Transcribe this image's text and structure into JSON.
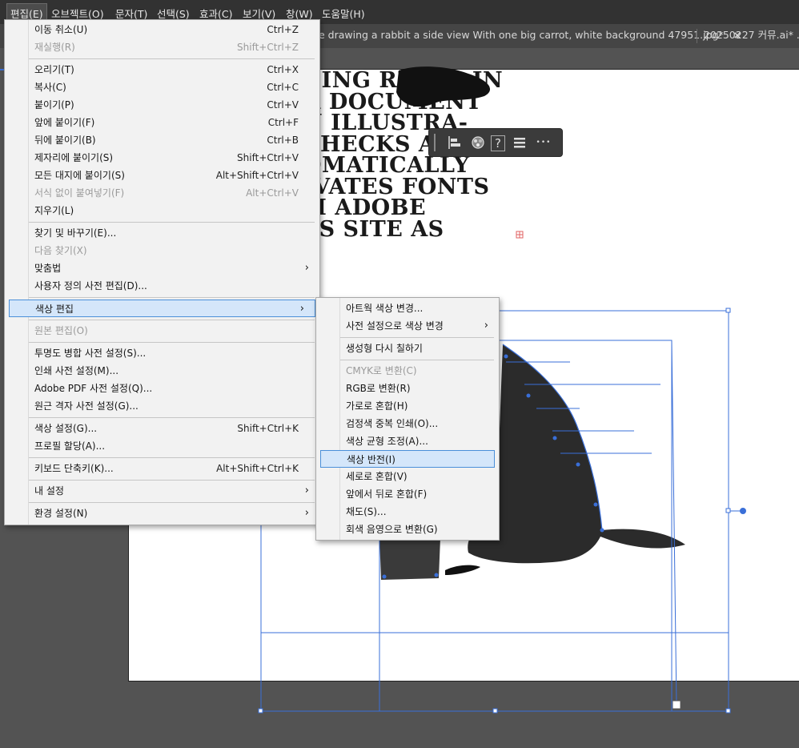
{
  "menubar": {
    "items": [
      "편집(E)",
      "오브젝트(O)",
      "문자(T)",
      "선택(S)",
      "효과(C)",
      "보기(V)",
      "창(W)",
      "도움말(H)"
    ]
  },
  "tabs": [
    {
      "label": "e drawing a rabbit a side view With one big carrot, white background 47951.jpg*",
      "close": "×"
    },
    {
      "label": "20250227 커뮤.ai* ..."
    }
  ],
  "artwork_text": [
    "GING RECTS IN",
    "R DOCUMENT",
    "N ILLUSTRA-",
    " CHECKS AND",
    "OMATICALLY",
    "IVATES FONTS",
    "M ADOBE",
    "TS SITE AS"
  ],
  "toolbar_icons": [
    "align-icon",
    "recolor-icon",
    "help-icon",
    "menu-lines-icon",
    "more-icon"
  ],
  "toolbar_help_glyph": "?",
  "toolbar_more_glyph": "•••",
  "edit_menu": {
    "items": [
      {
        "label": "이동 취소(U)",
        "shortcut": "Ctrl+Z",
        "disabled": false
      },
      {
        "label": "재실행(R)",
        "shortcut": "Shift+Ctrl+Z",
        "disabled": true
      },
      {
        "sep": true
      },
      {
        "label": "오리기(T)",
        "shortcut": "Ctrl+X",
        "disabled": false
      },
      {
        "label": "복사(C)",
        "shortcut": "Ctrl+C",
        "disabled": false
      },
      {
        "label": "붙이기(P)",
        "shortcut": "Ctrl+V",
        "disabled": false
      },
      {
        "label": "앞에 붙이기(F)",
        "shortcut": "Ctrl+F",
        "disabled": false
      },
      {
        "label": "뒤에 붙이기(B)",
        "shortcut": "Ctrl+B",
        "disabled": false
      },
      {
        "label": "제자리에 붙이기(S)",
        "shortcut": "Shift+Ctrl+V",
        "disabled": false
      },
      {
        "label": "모든 대지에 붙이기(S)",
        "shortcut": "Alt+Shift+Ctrl+V",
        "disabled": false
      },
      {
        "label": "서식 없이 붙여넣기(F)",
        "shortcut": "Alt+Ctrl+V",
        "disabled": true
      },
      {
        "label": "지우기(L)",
        "shortcut": "",
        "disabled": false
      },
      {
        "sep": true
      },
      {
        "label": "찾기 및 바꾸기(E)...",
        "shortcut": "",
        "disabled": false
      },
      {
        "label": "다음 찾기(X)",
        "shortcut": "",
        "disabled": true
      },
      {
        "label": "맞춤법",
        "shortcut": "",
        "disabled": false,
        "submenu": true
      },
      {
        "label": "사용자 정의 사전 편집(D)...",
        "shortcut": "",
        "disabled": false
      },
      {
        "sep": true
      },
      {
        "label": "색상 편집",
        "shortcut": "",
        "disabled": false,
        "submenu": true,
        "highlighted": true
      },
      {
        "sep": true
      },
      {
        "label": "원본 편집(O)",
        "shortcut": "",
        "disabled": true
      },
      {
        "sep": true
      },
      {
        "label": "투명도 병합 사전 설정(S)...",
        "shortcut": "",
        "disabled": false
      },
      {
        "label": "인쇄 사전 설정(M)...",
        "shortcut": "",
        "disabled": false
      },
      {
        "label": "Adobe PDF 사전 설정(Q)...",
        "shortcut": "",
        "disabled": false
      },
      {
        "label": "원근 격자 사전 설정(G)...",
        "shortcut": "",
        "disabled": false
      },
      {
        "sep": true
      },
      {
        "label": "색상 설정(G)...",
        "shortcut": "Shift+Ctrl+K",
        "disabled": false
      },
      {
        "label": "프로필 할당(A)...",
        "shortcut": "",
        "disabled": false
      },
      {
        "sep": true
      },
      {
        "label": "키보드 단축키(K)...",
        "shortcut": "Alt+Shift+Ctrl+K",
        "disabled": false
      },
      {
        "sep": true
      },
      {
        "label": "내 설정",
        "shortcut": "",
        "disabled": false,
        "submenu": true
      },
      {
        "sep": true
      },
      {
        "label": "환경 설정(N)",
        "shortcut": "",
        "disabled": false,
        "submenu": true
      }
    ]
  },
  "color_submenu": {
    "items": [
      {
        "label": "아트웍 색상 변경...",
        "disabled": false
      },
      {
        "label": "사전 설정으로 색상 변경",
        "disabled": false,
        "submenu": true
      },
      {
        "sep": true
      },
      {
        "label": "생성형 다시 칠하기",
        "disabled": false
      },
      {
        "sep": true
      },
      {
        "label": "CMYK로 변환(C)",
        "disabled": true
      },
      {
        "label": "RGB로 변환(R)",
        "disabled": false
      },
      {
        "label": "가로로 혼합(H)",
        "disabled": false
      },
      {
        "label": "검정색 중복 인쇄(O)...",
        "disabled": false
      },
      {
        "label": "색상 균형 조정(A)...",
        "disabled": false
      },
      {
        "label": "색상 반전(I)",
        "disabled": false,
        "highlighted": true
      },
      {
        "label": "세로로 혼합(V)",
        "disabled": false
      },
      {
        "label": "앞에서 뒤로 혼합(F)",
        "disabled": false
      },
      {
        "label": "채도(S)...",
        "disabled": false
      },
      {
        "label": "회색 음영으로 변환(G)",
        "disabled": false
      }
    ]
  },
  "colors": {
    "selection": "#3a6fd8",
    "menu_bg": "#f2f2f2",
    "highlight_bg": "#d4e6fa",
    "highlight_border": "#4a8fd9"
  }
}
